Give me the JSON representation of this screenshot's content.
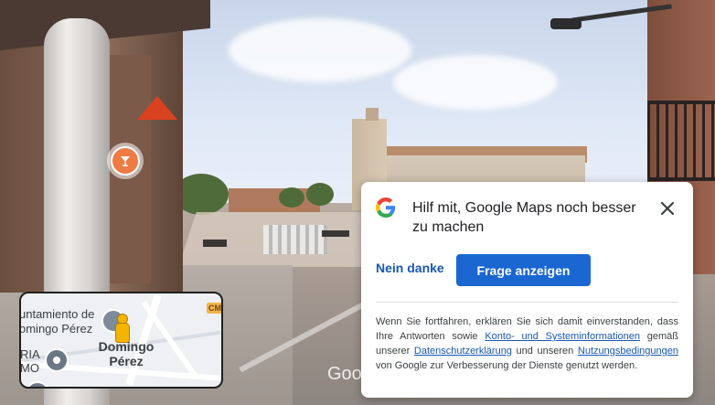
{
  "street_view": {
    "watermark": "Goo"
  },
  "poi_marker": {
    "icon": "cocktail-glass-icon"
  },
  "minimap": {
    "label_top": "untamiento de",
    "label_top2": "omingo Pérez",
    "label_left1": "RIA",
    "label_left2": "MO",
    "place_line1": "Domingo",
    "place_line2": "Pérez",
    "road_badge": "CM"
  },
  "dialog": {
    "title": "Hilf mit, Google Maps noch besser zu machen",
    "close_icon": "close-icon",
    "decline_label": "Nein danke",
    "accept_label": "Frage anzeigen",
    "legal": {
      "part1": "Wenn Sie fortfahren, erklären Sie sich damit einverstanden, dass Ihre Antworten sowie ",
      "link1": "Konto- und Systeminformationen",
      "part2": " gemäß unserer ",
      "link2": "Datenschutzerklärung",
      "part3": " und unseren ",
      "link3": "Nutzungsbedingungen",
      "part4": " von Google zur Verbesserung der Dienste genutzt werden."
    },
    "colors": {
      "primary": "#1a67d2",
      "link": "#1a57b0"
    }
  }
}
